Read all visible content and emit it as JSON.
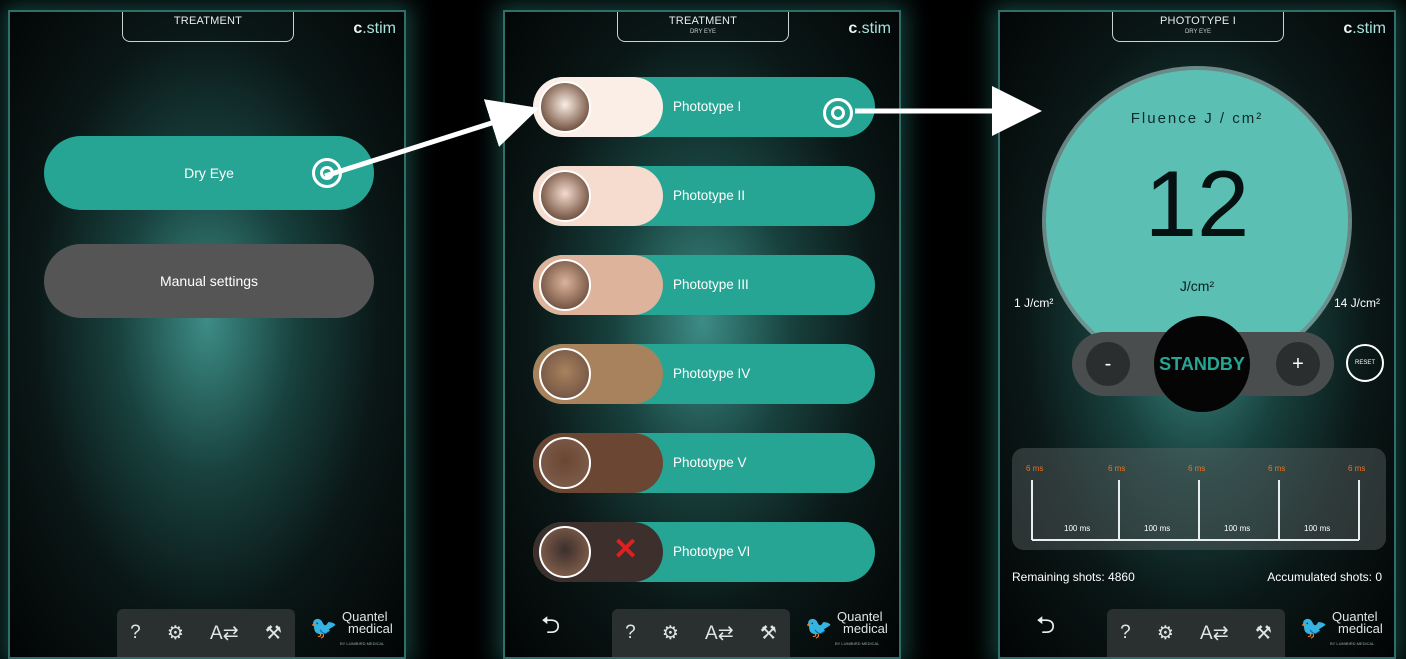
{
  "screen1": {
    "header": "TREATMENT",
    "logo": "stim",
    "buttons": {
      "dry_eye": "Dry Eye",
      "manual": "Manual settings"
    }
  },
  "screen2": {
    "header": "TREATMENT",
    "subheader": "DRY EYE",
    "logo": "stim",
    "phototypes": [
      {
        "label": "Phototype I",
        "skin": "#fbeee6"
      },
      {
        "label": "Phototype II",
        "skin": "#f5dccf"
      },
      {
        "label": "Phototype III",
        "skin": "#ddb39b"
      },
      {
        "label": "Phototype IV",
        "skin": "#a8825c"
      },
      {
        "label": "Phototype V",
        "skin": "#6b4632"
      },
      {
        "label": "Phototype VI",
        "skin": "#3c2f2c"
      }
    ]
  },
  "screen3": {
    "header": "PHOTOTYPE I",
    "subheader": "DRY EYE",
    "logo": "stim",
    "fluence_title": "Fluence J / cm²",
    "fluence_value": "12",
    "fluence_unit": "J/cm²",
    "min_label": "1 J/cm²",
    "max_label": "14 J/cm²",
    "minus": "-",
    "plus": "+",
    "standby": "STANDBY",
    "reset": "RESET",
    "pulses": [
      "6 ms",
      "6 ms",
      "6 ms",
      "6 ms",
      "6 ms"
    ],
    "intervals": [
      "100 ms",
      "100 ms",
      "100 ms",
      "100 ms"
    ],
    "remaining": "Remaining shots: 4860",
    "accumulated": "Accumulated shots: 0"
  },
  "toolbar": {
    "help": "?",
    "settings": "⚙",
    "language": "A⇄",
    "tools": "⚒"
  },
  "brand": {
    "line1": "Quantel",
    "line2": "medical",
    "line3": "BY LUMIBIRD MEDICAL"
  },
  "colors": {
    "accent": "#27a594",
    "danger": "#e02020",
    "pulse_label": "#f07020"
  }
}
